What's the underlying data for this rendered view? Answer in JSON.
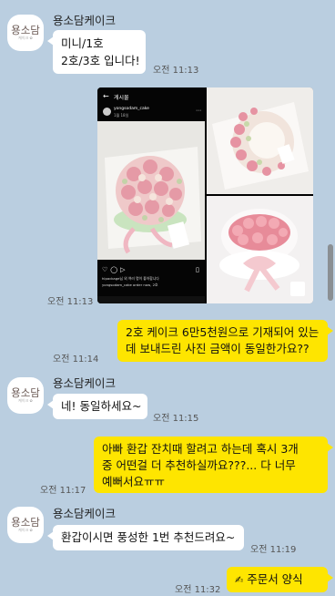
{
  "chat": {
    "group1": {
      "sender": "용소담케이크",
      "avatar_text": "용소담",
      "avatar_sub": "케이크 ✿",
      "message_line1": "미니/1호",
      "message_line2": "2호/3호 입니다!",
      "time": "오전 11:13"
    },
    "photo_post": {
      "header_title": "게시물",
      "account": "yongsodam_cake",
      "location": "1월 18일",
      "liked_by": "hlpackage님 외 여러 명이 좋아합니다",
      "caption": "yongsodam_cake  order now, 2호",
      "time": "오전 11:13"
    },
    "my_message1": {
      "line1": "2호 케이크 6만5천원으로 기재되어 있는",
      "line2": "데 보내드린 사진 금액이 동일한가요??",
      "time": "오전 11:14"
    },
    "group2": {
      "sender": "용소담케이크",
      "avatar_text": "용소담",
      "avatar_sub": "케이크 ✿",
      "message": "네! 동일하세요~",
      "time": "오전 11:15"
    },
    "my_message2": {
      "line1": "아빠 환갑 잔치때 할려고 하는데 혹시 3개",
      "line2": "중 어떤걸 더 추천하실까요???... 다 너무",
      "line3": "예뻐서요ㅠㅠ",
      "time": "오전 11:17"
    },
    "group3": {
      "sender": "용소담케이크",
      "avatar_text": "용소담",
      "avatar_sub": "케이크 ✿",
      "message": "환갑이시면 풍성한 1번 추천드려요~",
      "time": "오전 11:19"
    },
    "my_message3": {
      "icon": "pencil-icon",
      "text": "주문서 양식",
      "time": "오전 11:32"
    }
  },
  "colors": {
    "background": "#bacee0",
    "my_bubble": "#fee500",
    "their_bubble": "#ffffff"
  }
}
